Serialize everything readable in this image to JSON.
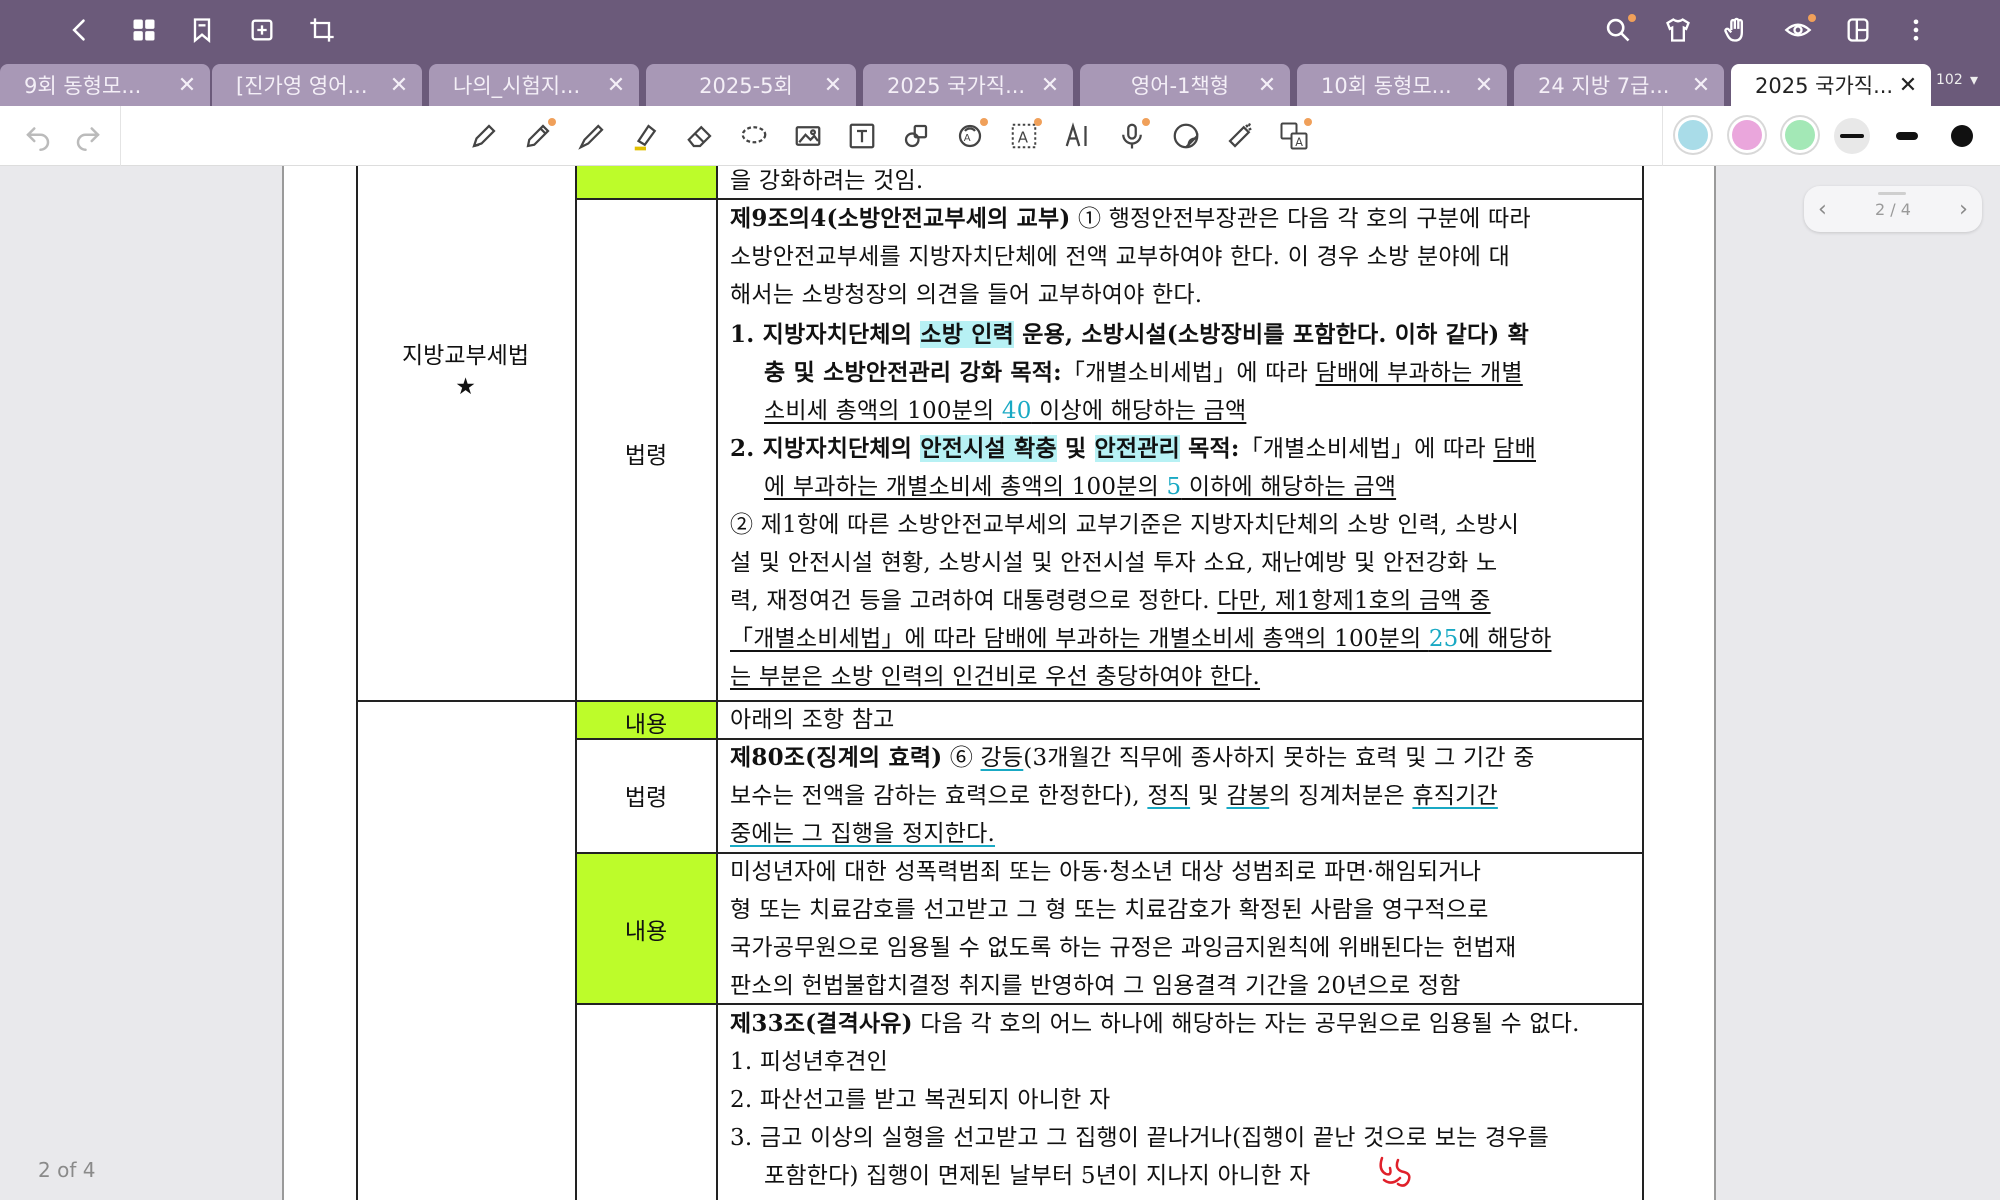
{
  "tabs": [
    {
      "label": "9회 동형모...",
      "active": false
    },
    {
      "label": "[진가영 영어...",
      "active": false
    },
    {
      "label": "나의_시험지...",
      "active": false
    },
    {
      "label": "2025-5회",
      "active": false
    },
    {
      "label": "2025 국가직...",
      "active": false
    },
    {
      "label": "영어-1책형",
      "active": false
    },
    {
      "label": "10회 동형모...",
      "active": false
    },
    {
      "label": "24 지방 7급...",
      "active": false
    },
    {
      "label": "2025 국가직...",
      "active": true
    }
  ],
  "tab_close": "✕",
  "tab_count": "102",
  "tab_more": "▾",
  "colors": {
    "topbar": "#6b5a7a",
    "highlight_green": "#bdfc2a",
    "highlight_cyan": "#b7f1f4",
    "swatch_blue": "#a9dce8",
    "swatch_pink": "#eaa6dc",
    "swatch_green": "#a3e8b6"
  },
  "page_indicator": {
    "prev": "‹",
    "label": "2 / 4",
    "next": "›"
  },
  "page_of": "2 of 4",
  "doc": {
    "row0_tail": "을 강화하려는 것임.",
    "law_name": "지방교부세법",
    "law_star": "★",
    "label_law": "법령",
    "label_content": "내용",
    "r1": {
      "title": "제9조의4(소방안전교부세의 교부)",
      "l1": " ① 행정안전부장관은 다음 각 호의 구분에 따라",
      "l2": "소방안전교부세를 지방자치단체에 전액 교부하여야 한다. 이 경우 소방 분야에 대",
      "l3": "해서는 소방청장의 의견을 들어 교부하여야 한다.",
      "i1a": "1. 지방자치단체의 ",
      "i1b": "소방 인력",
      "i1c": " 운용, 소방시설(소방장비를 포함한다. 이하 같다) 확",
      "i1d": "충 및 소방안전관리 강화 목적:",
      "i1e": "「개별소비세법」에 따라 ",
      "i1f": "담배에 부과하는 개별",
      "i1g": "소비세 총액의 100분의 ",
      "i1h": "40",
      "i1i": " 이상에 해당하는 금액",
      "i2a": "2. 지방자치단체의 ",
      "i2b": "안전시설 확충",
      "i2c": " 및 ",
      "i2d": "안전관리",
      "i2e": " 목적:",
      "i2f": "「개별소비세법」에 따라 ",
      "i2g": "담배",
      "i2h": "에 부과하는 개별소비세 총액의 100분의 ",
      "i2i": "5",
      "i2j": " 이하에 해당하는 금액",
      "p2l1": "② 제1항에 따른 소방안전교부세의 교부기준은 지방자치단체의 소방 인력, 소방시",
      "p2l2": "설 및 안전시설 현황, 소방시설 및 안전시설 투자 소요, 재난예방 및 안전강화 노",
      "p2l3a": "력, 재정여건 등을 고려하여 대통령령으로 정한다. ",
      "p2l3b": "다만, 제1항제1호의 금액 중",
      "p2l4a": "「개별소비세법」에 따라 담배에 부과하는 개별소비세 총액의 100분의 ",
      "p2l4b": "25",
      "p2l4c": "에 해당하",
      "p2l5": "는 부분은 소방 인력의 인건비로 우선 충당하여야 한다."
    },
    "r2": {
      "content": "아래의 조항 참고",
      "title": "제80조(징계의 효력)",
      "l1a": " ⑥ ",
      "l1b": "강등",
      "l1c": "(3개월간 직무에 종사하지 못하는 효력 및 그 기간 중",
      "l2a": "보수는 전액을 감하는 효력으로 한정한다), ",
      "l2b": "정직",
      "l2c": " 및 ",
      "l2d": "감봉",
      "l2e": "의 징계처분은 ",
      "l2f": "휴직기간",
      "l3": "중에는 그 집행을 정지한다."
    },
    "r3": {
      "l1": "미성년자에 대한 성폭력범죄 또는 아동·청소년 대상 성범죄로 파면·해임되거나",
      "l2": "형 또는 치료감호를 선고받고 그 형 또는 치료감호가 확정된 사람을 영구적으로",
      "l3": "국가공무원으로 임용될 수 없도록 하는 규정은 과잉금지원칙에 위배된다는 헌법재",
      "l4": "판소의 헌법불합치결정 취지를 반영하여 그 임용결격 기간을 20년으로 정함"
    },
    "r4": {
      "title": "제33조(결격사유)",
      "l1": " 다음 각 호의 어느 하나에 해당하는 자는 공무원으로 임용될 수 없다.",
      "i1": "1. 피성년후견인",
      "i2": "2. 파산선고를 받고 복권되지 아니한 자",
      "i3": "3. 금고 이상의 실형을 선고받고 그 집행이 끝나거나(집행이 끝난 것으로 보는 경우를",
      "i3b": "포함한다) 집행이 면제된 날부터 5년이 지나지 아니한 자"
    }
  }
}
